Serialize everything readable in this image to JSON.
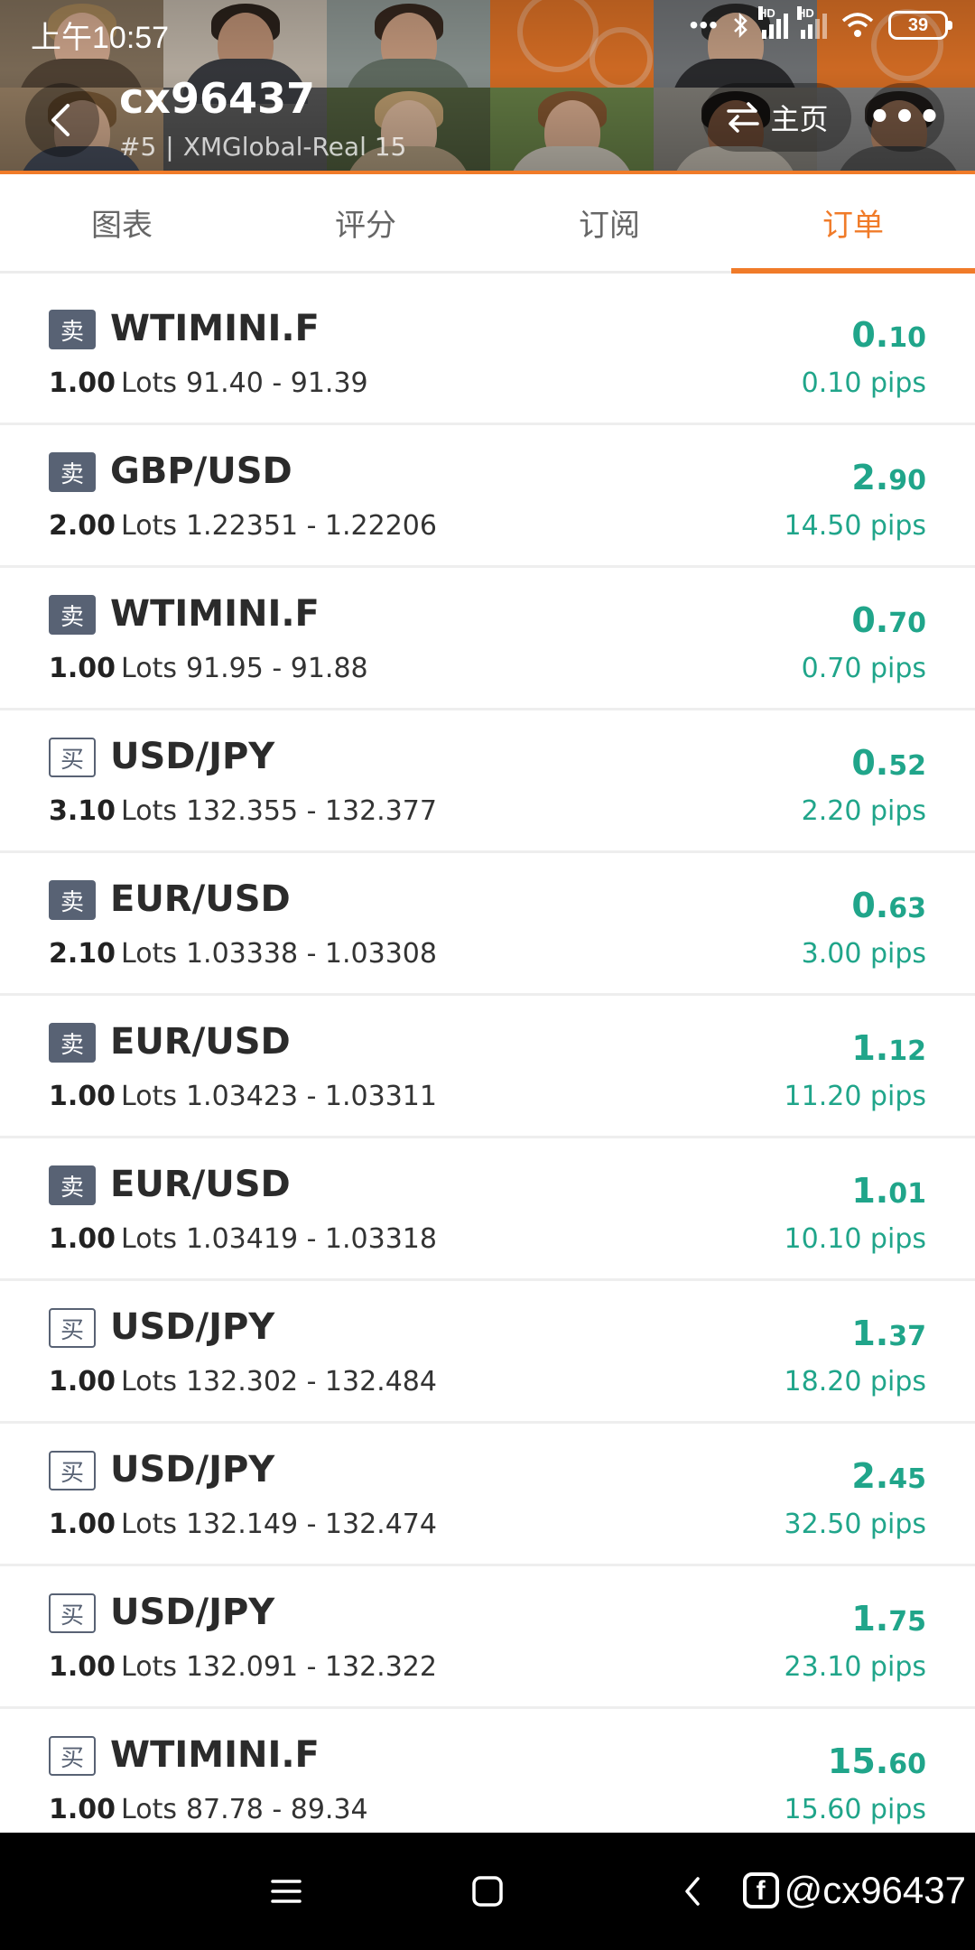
{
  "status_bar": {
    "time": "上午10:57",
    "battery": "39"
  },
  "header": {
    "username": "cx96437",
    "rank": "#5",
    "server": "XMGlobal-Real 15",
    "home_label": "主页"
  },
  "tabs": [
    {
      "label": "图表"
    },
    {
      "label": "评分"
    },
    {
      "label": "订阅"
    },
    {
      "label": "订单"
    }
  ],
  "active_tab": "订单",
  "orders": [
    {
      "side": "卖",
      "type": "sell",
      "symbol": "WTIMINI.F",
      "lots": "1.00",
      "lots_unit": "Lots",
      "prices": "91.40 - 91.39",
      "profit_int": "0.",
      "profit_dec": "10",
      "pips": "0.10 pips"
    },
    {
      "side": "卖",
      "type": "sell",
      "symbol": "GBP/USD",
      "lots": "2.00",
      "lots_unit": "Lots",
      "prices": "1.22351 - 1.22206",
      "profit_int": "2.",
      "profit_dec": "90",
      "pips": "14.50 pips"
    },
    {
      "side": "卖",
      "type": "sell",
      "symbol": "WTIMINI.F",
      "lots": "1.00",
      "lots_unit": "Lots",
      "prices": "91.95 - 91.88",
      "profit_int": "0.",
      "profit_dec": "70",
      "pips": "0.70 pips"
    },
    {
      "side": "买",
      "type": "buy",
      "symbol": "USD/JPY",
      "lots": "3.10",
      "lots_unit": "Lots",
      "prices": "132.355 - 132.377",
      "profit_int": "0.",
      "profit_dec": "52",
      "pips": "2.20 pips"
    },
    {
      "side": "卖",
      "type": "sell",
      "symbol": "EUR/USD",
      "lots": "2.10",
      "lots_unit": "Lots",
      "prices": "1.03338 - 1.03308",
      "profit_int": "0.",
      "profit_dec": "63",
      "pips": "3.00 pips"
    },
    {
      "side": "卖",
      "type": "sell",
      "symbol": "EUR/USD",
      "lots": "1.00",
      "lots_unit": "Lots",
      "prices": "1.03423 - 1.03311",
      "profit_int": "1.",
      "profit_dec": "12",
      "pips": "11.20 pips"
    },
    {
      "side": "卖",
      "type": "sell",
      "symbol": "EUR/USD",
      "lots": "1.00",
      "lots_unit": "Lots",
      "prices": "1.03419 - 1.03318",
      "profit_int": "1.",
      "profit_dec": "01",
      "pips": "10.10 pips"
    },
    {
      "side": "买",
      "type": "buy",
      "symbol": "USD/JPY",
      "lots": "1.00",
      "lots_unit": "Lots",
      "prices": "132.302 - 132.484",
      "profit_int": "1.",
      "profit_dec": "37",
      "pips": "18.20 pips"
    },
    {
      "side": "买",
      "type": "buy",
      "symbol": "USD/JPY",
      "lots": "1.00",
      "lots_unit": "Lots",
      "prices": "132.149 - 132.474",
      "profit_int": "2.",
      "profit_dec": "45",
      "pips": "32.50 pips"
    },
    {
      "side": "买",
      "type": "buy",
      "symbol": "USD/JPY",
      "lots": "1.00",
      "lots_unit": "Lots",
      "prices": "132.091 - 132.322",
      "profit_int": "1.",
      "profit_dec": "75",
      "pips": "23.10 pips"
    },
    {
      "side": "买",
      "type": "buy",
      "symbol": "WTIMINI.F",
      "lots": "1.00",
      "lots_unit": "Lots",
      "prices": "87.78 - 89.34",
      "profit_int": "15.",
      "profit_dec": "60",
      "pips": "15.60 pips"
    }
  ],
  "watermark": "@cx96437",
  "icons": {
    "back": "chevron-left-icon",
    "swap": "swap-arrows-icon",
    "more": "more-dots-icon",
    "menu": "menu-icon",
    "home": "home-square-icon",
    "nav_back": "nav-back-icon",
    "facebook": "facebook-icon"
  },
  "colors": {
    "accent": "#f07b29",
    "profit": "#20a58a",
    "sell_badge": "#586274",
    "tab_inactive": "#666666",
    "navbar": "#000000"
  }
}
